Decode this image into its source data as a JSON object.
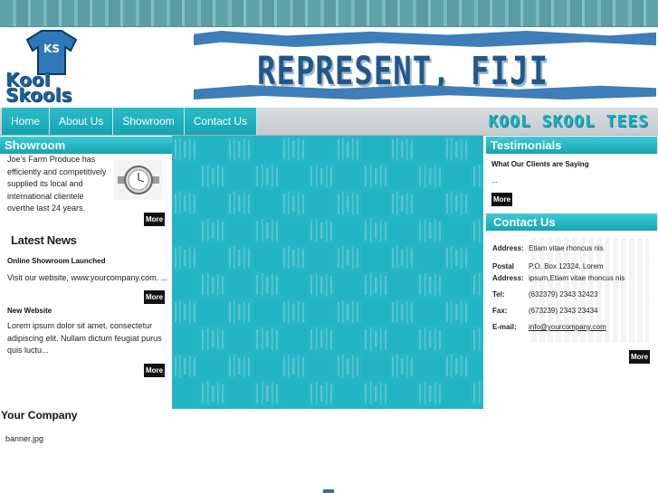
{
  "logo": {
    "badge": "KS",
    "line1": "Kool",
    "line2": "Skools"
  },
  "banner": {
    "title": "REPRESENT, FIJI"
  },
  "nav": {
    "items": [
      "Home",
      "About Us",
      "Showroom",
      "Contact Us"
    ],
    "tagline": "KOOL SKOOL TEES"
  },
  "showroom": {
    "heading": "Showroom",
    "text": "Joe's Farm Produce has efficiently and competitively supplied its local and international clientele overthe last 24 years.",
    "more": "More"
  },
  "news": {
    "heading": "Latest News",
    "items": [
      {
        "title": "Online Showroom Launched",
        "body": "Visit our website, www.yourcompany.com. ...",
        "more": "More"
      },
      {
        "title": "New Website",
        "body": "Lorem ipsum dolor sit amet, consectetur adipiscing elit. Nullam dictum feugiat purus quis luctu...",
        "more": "More"
      }
    ]
  },
  "testimonials": {
    "heading": "Testimonials",
    "subheading": "What Our Clients are Saying",
    "text": "...",
    "more": "More"
  },
  "contact": {
    "heading": "Contact Us",
    "address_label": "Address:",
    "address_value": "Etiam vitae rhoncus nis",
    "postal_label_1": "Postal",
    "postal_label_2": "Address:",
    "postal_value": "P.O. Box 12324, Lorem ipsum,Etiam vitae rhoncus nis",
    "tel_label": "Tel:",
    "tel_value": "(632379) 2343 32423",
    "fax_label": "Fax:",
    "fax_value": "(673239) 2343  23434",
    "email_label": "E-mail:",
    "email_value": "info@yourcompany.com",
    "more": "More"
  },
  "footer": {
    "company": "Your Company",
    "banner": "banner.jpg"
  },
  "colors": {
    "accent": "#22b4c3",
    "brand_blue": "#3d7db8",
    "nav_bar": "#c6cbcf"
  }
}
